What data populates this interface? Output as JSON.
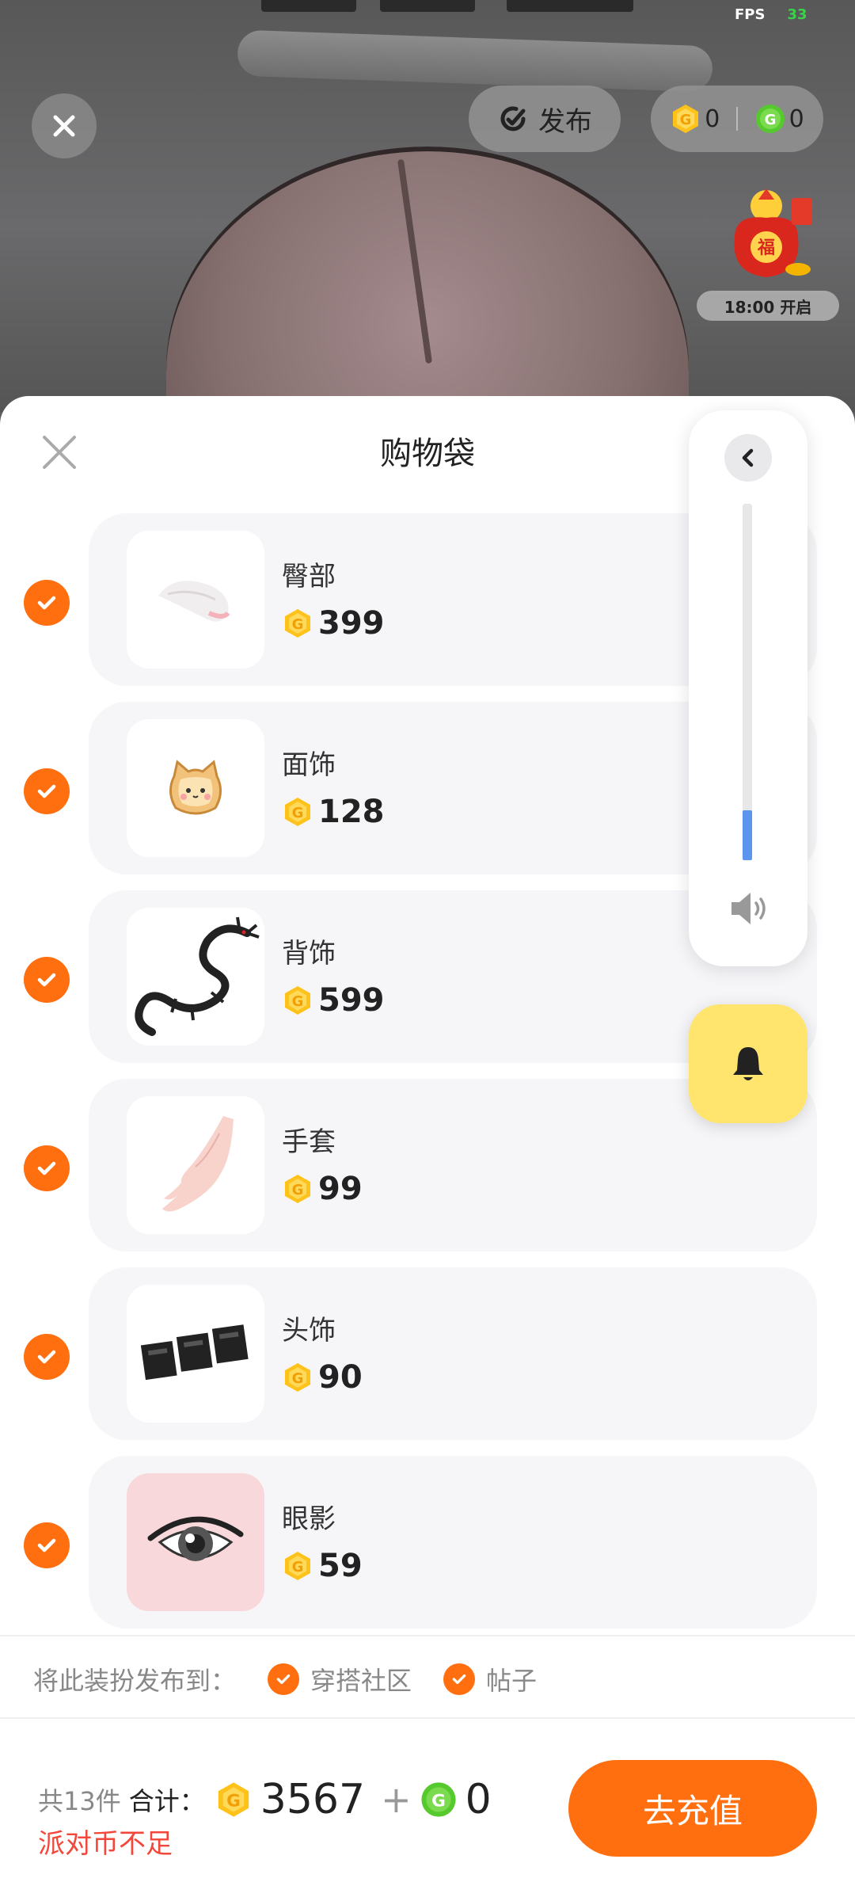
{
  "status": {
    "fps_label": "FPS",
    "fps_value": "33"
  },
  "topbar": {
    "publish_label": "发布",
    "gold_balance": "0",
    "green_balance": "0",
    "event_timer": "18:00 开启"
  },
  "sheet": {
    "title": "购物袋",
    "items": [
      {
        "name": "臀部",
        "price": "399",
        "thumb": "tail"
      },
      {
        "name": "面饰",
        "price": "128",
        "thumb": "bread-cat"
      },
      {
        "name": "背饰",
        "price": "599",
        "thumb": "dragon"
      },
      {
        "name": "手套",
        "price": "99",
        "thumb": "hand"
      },
      {
        "name": "头饰",
        "price": "90",
        "thumb": "text-badge"
      },
      {
        "name": "眼影",
        "price": "59",
        "thumb": "eye"
      }
    ]
  },
  "volume": {
    "level": 0.14
  },
  "publish_to": {
    "label": "将此装扮发布到：",
    "options": [
      "穿搭社区",
      "帖子"
    ]
  },
  "footer": {
    "count_text": "共13件",
    "total_label": "合计：",
    "gold_total": "3567",
    "plus": "+",
    "green_total": "0",
    "warning": "派对币不足",
    "recharge_label": "去充值"
  },
  "colors": {
    "accent": "#ff6f0f",
    "warning": "#f2473a",
    "volume_fill": "#5b95ee",
    "bell_bg": "#ffe46d"
  }
}
